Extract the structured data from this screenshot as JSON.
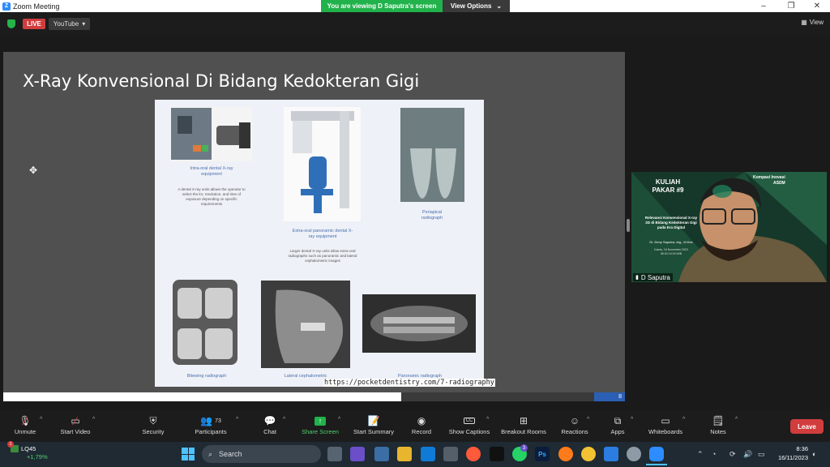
{
  "window": {
    "title": "Zoom Meeting",
    "viewing_text": "You are viewing D Saputra's screen",
    "view_options": "View Options"
  },
  "topbar": {
    "live_badge": "LIVE",
    "youtube_label": "YouTube",
    "view_label": "View"
  },
  "slide": {
    "title": "X-Ray Konvensional Di Bidang Kedokteran Gigi",
    "items": [
      {
        "caption": "Intra-oral dental X-ray equipment",
        "description": "A dental X-ray units allows the operator to select the kV, resolution, and time of exposure depending on specific requirements"
      },
      {
        "caption": "Extra-oral panoramic dental X-ray equipment",
        "description": "Larger dental X-ray units allow extra-oral radiographs such as panoramic and lateral cephalometric images"
      },
      {
        "caption": "Periapical radiograph",
        "description": ""
      },
      {
        "caption": "Bitewing radiograph",
        "description": ""
      },
      {
        "caption": "Lateral cephalometric",
        "description": ""
      },
      {
        "caption": "Panoramic radiograph",
        "description": ""
      }
    ],
    "source_url": "https://pocketdentistry.com/7-radiography",
    "page_number": "8",
    "progress_fraction": 0.64
  },
  "video": {
    "participant_name": "D Saputra",
    "banner_line1": "KULIAH",
    "banner_line2": "PAKAR #9",
    "banner_text": "Relevansi Konvensional X-ray 2D di Bidang Kedokteran Gigi pada Era Digital",
    "banner_speaker": "Dr. Deny Saputra, drg., M.Kes",
    "banner_date": "Kamis, 16 November 2023",
    "banner_time": "08.00-10.00 WIB",
    "banner_logo_text": "Kompasi Inovasi",
    "banner_logo_text2": "ASDM"
  },
  "toolbar": {
    "items": [
      {
        "label": "Unmute",
        "icon": "mic-muted-icon"
      },
      {
        "label": "Start Video",
        "icon": "video-off-icon"
      },
      {
        "label": "Security",
        "icon": "shield-icon"
      },
      {
        "label": "Participants",
        "icon": "participants-icon",
        "count": "73"
      },
      {
        "label": "Chat",
        "icon": "chat-icon"
      },
      {
        "label": "Share Screen",
        "icon": "share-screen-icon"
      },
      {
        "label": "Start Summary",
        "icon": "summary-icon"
      },
      {
        "label": "Record",
        "icon": "record-icon"
      },
      {
        "label": "Show Captions",
        "icon": "captions-icon",
        "icon_text": "CC"
      },
      {
        "label": "Breakout Rooms",
        "icon": "breakout-icon"
      },
      {
        "label": "Reactions",
        "icon": "reactions-icon"
      },
      {
        "label": "Apps",
        "icon": "apps-icon"
      },
      {
        "label": "Whiteboards",
        "icon": "whiteboard-icon"
      },
      {
        "label": "Notes",
        "icon": "notes-icon"
      }
    ],
    "leave_label": "Leave"
  },
  "taskbar": {
    "stock_name": "LQ45",
    "stock_change": "+1,79%",
    "stock_badge": "1",
    "search_placeholder": "Search",
    "time": "8:36",
    "date": "16/11/2023",
    "whatsapp_badge": "3"
  }
}
